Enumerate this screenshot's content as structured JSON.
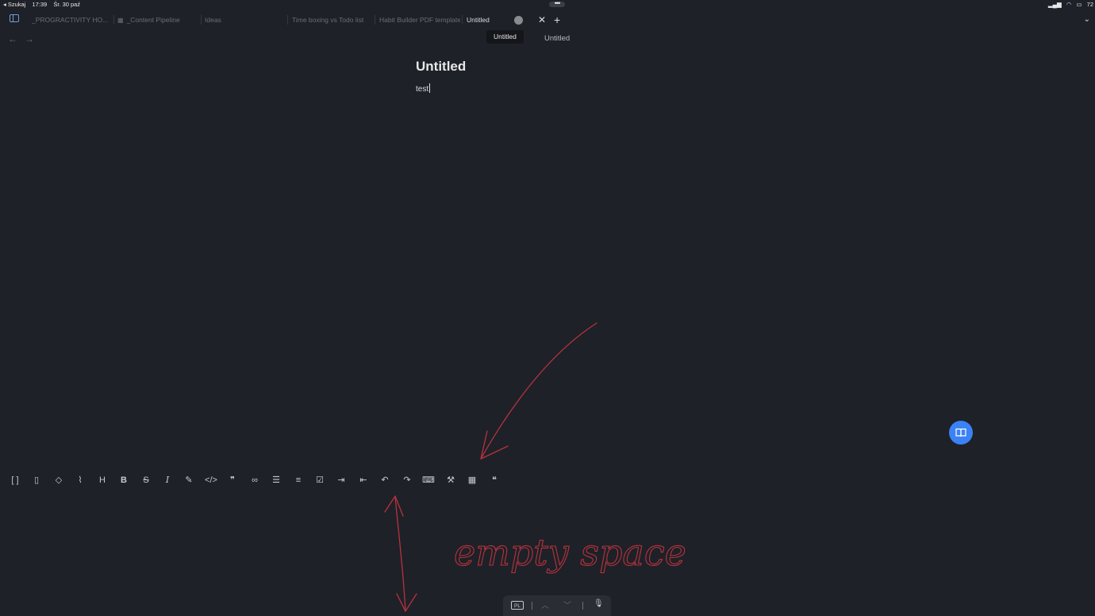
{
  "status_bar": {
    "back_app": "◂ Szukaj",
    "time": "17:39",
    "date": "Śr. 30 paź",
    "battery": "72"
  },
  "tabs": [
    {
      "label": "_PROGRACTIVITY HO...",
      "pinned": true
    },
    {
      "label": "_Content Pipeline"
    },
    {
      "label": "Ideas"
    },
    {
      "label": "Time boxing vs Todo list"
    },
    {
      "label": "Habit Builder PDF template"
    },
    {
      "label": "Untitled",
      "active": true
    }
  ],
  "header": {
    "tooltip": "Untitled",
    "view_title": "Untitled"
  },
  "note": {
    "title": "Untitled",
    "body": "test"
  },
  "annotation": {
    "text": "empty space",
    "color": "#b8323f"
  },
  "colors": {
    "background": "#1e2127",
    "accent": "#3b82f6"
  },
  "toolbar_icons": [
    "wikilink-icon",
    "file-icon",
    "tag-icon",
    "attachment-icon",
    "heading-icon",
    "bold-icon",
    "strikethrough-icon",
    "italic-icon",
    "highlight-icon",
    "code-icon",
    "quote-icon",
    "link-icon",
    "bullet-list-icon",
    "numbered-list-icon",
    "checklist-icon",
    "indent-icon",
    "outdent-icon",
    "undo-icon",
    "redo-icon",
    "hide-keyboard-icon",
    "settings-icon",
    "table-icon",
    "blockquote-icon"
  ],
  "keyboard_bar": {
    "language": "PL"
  }
}
